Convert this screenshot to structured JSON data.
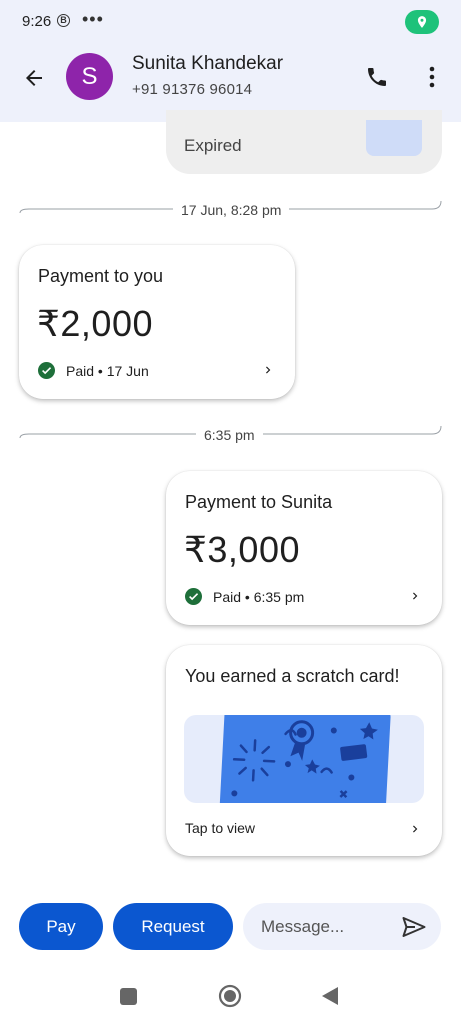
{
  "status_bar": {
    "time": "9:26",
    "b_badge": "B",
    "dots": "•••"
  },
  "header": {
    "avatar_initial": "S",
    "avatar_color": "#8e24aa",
    "name": "Sunita Khandekar",
    "phone": "+91 91376 96014"
  },
  "previous_message": {
    "status": "Expired"
  },
  "timestamps": [
    "17 Jun, 8:28 pm",
    "6:35 pm"
  ],
  "payments": [
    {
      "title": "Payment to you",
      "amount": "₹2,000",
      "status": "Paid • 17 Jun"
    },
    {
      "title": "Payment to Sunita",
      "amount": "₹3,000",
      "status": "Paid • 6:35 pm"
    }
  ],
  "scratch_card": {
    "title": "You earned a scratch card!",
    "action": "Tap to view"
  },
  "composer": {
    "pay_label": "Pay",
    "request_label": "Request",
    "message_placeholder": "Message..."
  },
  "colors": {
    "primary": "#0b57d0",
    "paid_green": "#1e6f3a",
    "header_bg": "#eef1fb",
    "location_green": "#1ec27a"
  }
}
